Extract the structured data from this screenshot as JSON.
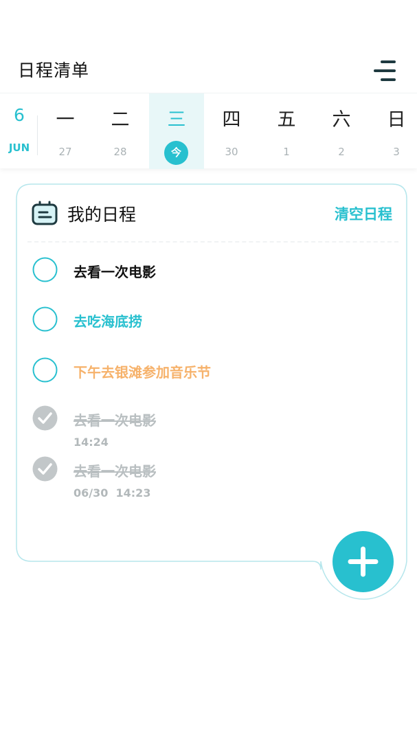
{
  "header": {
    "title": "日程清单",
    "menu_icon": "menu-lines-icon"
  },
  "calendar": {
    "month_number": "6",
    "month_name": "JUN",
    "days": [
      {
        "name": "一",
        "date": "27"
      },
      {
        "name": "二",
        "date": "28"
      },
      {
        "name": "三",
        "date": "今",
        "today": true
      },
      {
        "name": "四",
        "date": "30"
      },
      {
        "name": "五",
        "date": "1"
      },
      {
        "name": "六",
        "date": "2"
      },
      {
        "name": "日",
        "date": "3"
      }
    ]
  },
  "schedule": {
    "title": "我的日程",
    "icon": "calendar-card-icon",
    "clear_label": "清空日程",
    "tasks": [
      {
        "text": "去看一次电影",
        "done": false,
        "color": "#111111"
      },
      {
        "text": "去吃海底捞",
        "done": false,
        "color": "#28c0cf"
      },
      {
        "text": "下午去银滩参加音乐节",
        "done": false,
        "color": "#f6b26b"
      },
      {
        "text": "去看一次电影",
        "done": true,
        "time": "14:24"
      },
      {
        "text": "去看一次电影",
        "done": true,
        "time": "06/30  14:23"
      }
    ]
  },
  "fab": {
    "icon": "plus-icon"
  },
  "colors": {
    "accent": "#28c0cf",
    "done": "#c2c7c9",
    "orange": "#f6b26b",
    "today_bg": "#e8f7f8"
  }
}
